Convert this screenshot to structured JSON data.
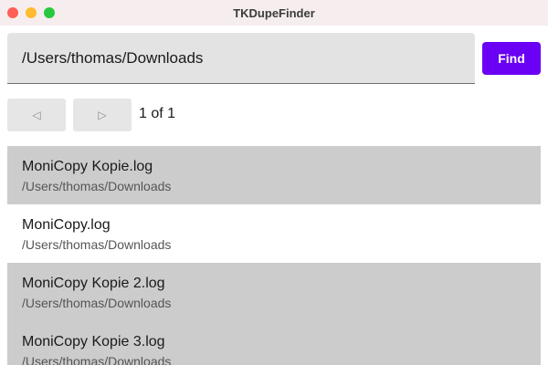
{
  "window": {
    "title": "TKDupeFinder"
  },
  "search": {
    "path_value": "/Users/thomas/Downloads",
    "find_label": "Find"
  },
  "pagination": {
    "prev_icon": "◁",
    "next_icon": "▷",
    "indicator": "1 of 1"
  },
  "results": [
    {
      "name": "MoniCopy Kopie.log",
      "path": "/Users/thomas/Downloads",
      "highlighted": true
    },
    {
      "name": "MoniCopy.log",
      "path": "/Users/thomas/Downloads",
      "highlighted": false
    },
    {
      "name": "MoniCopy Kopie 2.log",
      "path": "/Users/thomas/Downloads",
      "highlighted": true
    },
    {
      "name": "MoniCopy Kopie 3.log",
      "path": "/Users/thomas/Downloads",
      "highlighted": true
    }
  ],
  "colors": {
    "accent": "#6a00f4",
    "row_shaded": "#cccccc"
  }
}
